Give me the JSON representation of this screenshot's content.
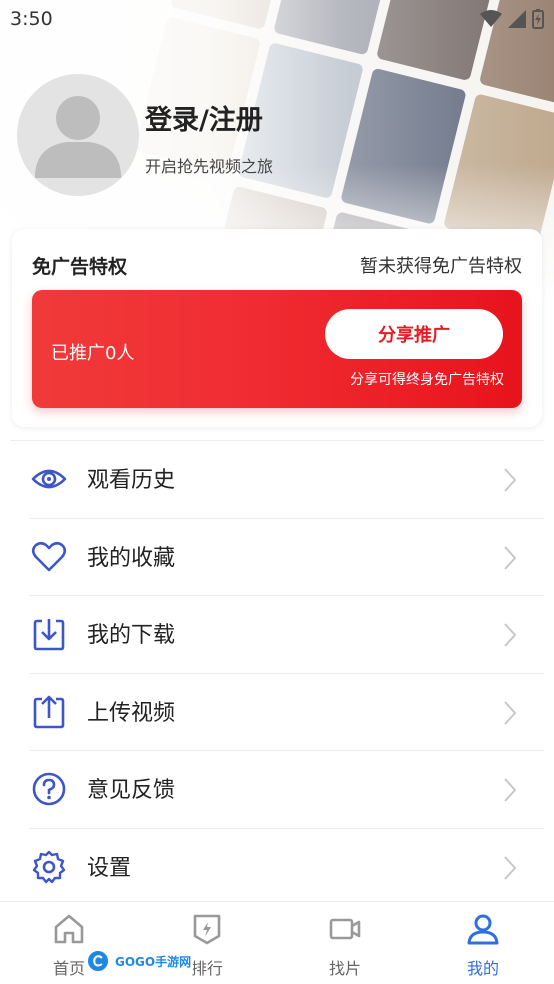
{
  "status_bar": {
    "time": "3:50"
  },
  "profile": {
    "login_title": "登录/注册",
    "subtitle": "开启抢先视频之旅"
  },
  "ad_free": {
    "title": "免广告特权",
    "status": "暂未获得免广告特权",
    "promoted_count": "已推广0人",
    "share_button": "分享推广",
    "share_note": "分享可得终身免广告特权"
  },
  "menu": {
    "items": [
      {
        "label": "观看历史",
        "icon": "eye-icon"
      },
      {
        "label": "我的收藏",
        "icon": "heart-icon"
      },
      {
        "label": "我的下载",
        "icon": "download-icon"
      },
      {
        "label": "上传视频",
        "icon": "upload-icon"
      },
      {
        "label": "意见反馈",
        "icon": "question-icon"
      },
      {
        "label": "设置",
        "icon": "gear-icon"
      }
    ]
  },
  "bottom_nav": {
    "items": [
      {
        "label": "首页",
        "icon": "home-icon"
      },
      {
        "label": "排行",
        "icon": "ranking-icon"
      },
      {
        "label": "找片",
        "icon": "video-camera-icon"
      },
      {
        "label": "我的",
        "icon": "user-icon",
        "active": true
      }
    ]
  },
  "watermark": {
    "text": "GOGO手游网"
  },
  "colors": {
    "accent_red": "#e81a23",
    "icon_blue": "#3d57c9",
    "nav_active": "#2f6fe0"
  }
}
